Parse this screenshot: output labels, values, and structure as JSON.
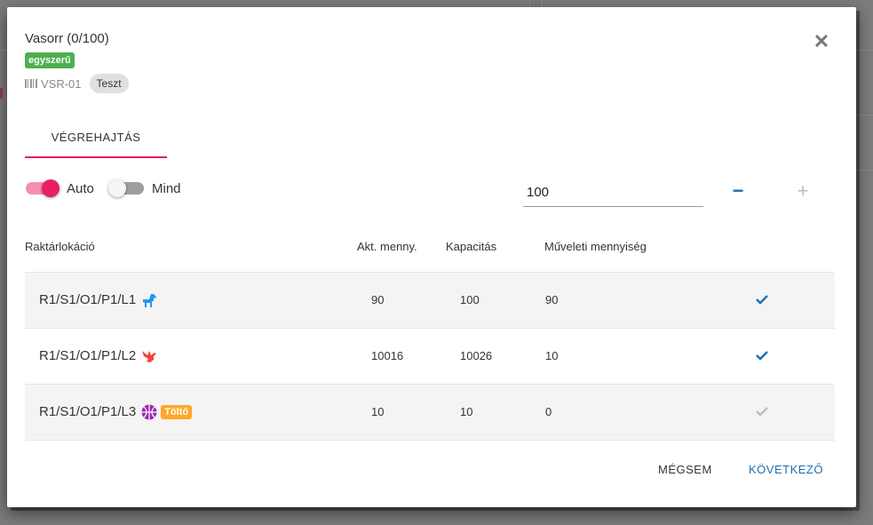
{
  "dialog": {
    "title": "Vasorr (0/100)",
    "badge": "egyszerű",
    "code": "VSR-01",
    "tag": "Teszt",
    "close_icon": "close-icon"
  },
  "tabs": [
    {
      "label": "VÉGREHAJTÁS",
      "active": true
    }
  ],
  "controls": {
    "auto_label": "Auto",
    "auto_on": true,
    "mind_label": "Mind",
    "mind_on": false,
    "quantity_value": "100",
    "minus_label": "−",
    "plus_label": "+"
  },
  "table": {
    "headers": {
      "location": "Raktárlokáció",
      "current_qty": "Akt. menny.",
      "capacity": "Kapacitás",
      "operation_qty": "Műveleti mennyiség"
    },
    "rows": [
      {
        "location": "R1/S1/O1/P1/L1",
        "icon": "horse-icon",
        "icon_color": "#2196f3",
        "badge": "",
        "current_qty": "90",
        "capacity": "100",
        "operation_qty": "90",
        "checked": true
      },
      {
        "location": "R1/S1/O1/P1/L2",
        "icon": "dove-icon",
        "icon_color": "#f44336",
        "badge": "",
        "current_qty": "10016",
        "capacity": "10026",
        "operation_qty": "10",
        "checked": true
      },
      {
        "location": "R1/S1/O1/P1/L3",
        "icon": "basketball-icon",
        "icon_color": "#9c27b0",
        "badge": "Töltő",
        "current_qty": "10",
        "capacity": "10",
        "operation_qty": "0",
        "checked": false
      }
    ]
  },
  "footer": {
    "cancel_label": "MÉGSEM",
    "next_label": "KÖVETKEZŐ"
  },
  "colors": {
    "accent": "#e91e63",
    "primary": "#1e6fb0",
    "badge_green": "#4caf50",
    "badge_orange": "#ffa726"
  }
}
